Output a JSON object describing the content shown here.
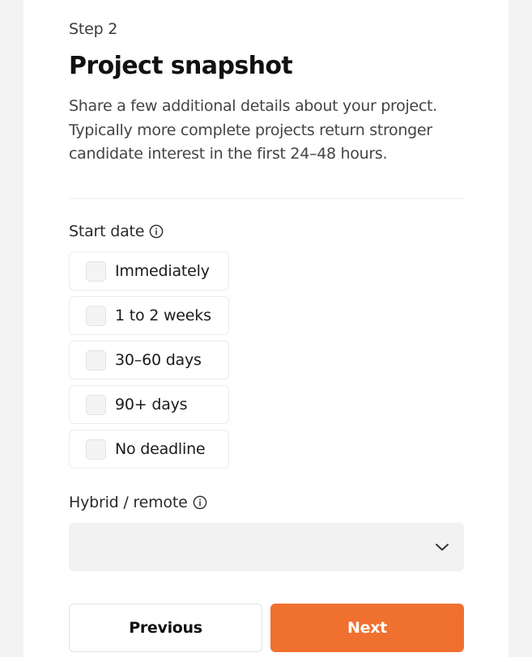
{
  "step_label": "Step 2",
  "title": "Project snapshot",
  "description": "Share a few additional details about your project. Typically more complete projects return stronger candidate interest in the first 24–48 hours.",
  "start_date": {
    "label": "Start date",
    "info_icon": "info-icon",
    "options": [
      {
        "label": "Immediately",
        "checked": false
      },
      {
        "label": "1 to 2 weeks",
        "checked": false
      },
      {
        "label": "30–60 days",
        "checked": false
      },
      {
        "label": "90+ days",
        "checked": false
      },
      {
        "label": "No deadline",
        "checked": false
      }
    ]
  },
  "work_mode": {
    "label": "Hybrid / remote",
    "info_icon": "info-icon",
    "selected_value": "",
    "chevron_icon": "chevron-down-icon"
  },
  "buttons": {
    "previous": "Previous",
    "next": "Next"
  },
  "colors": {
    "accent": "#f07030",
    "checkbox_bg": "#f4f4f4",
    "select_bg": "#f2f2f2",
    "page_bg": "#f3f3f3"
  }
}
